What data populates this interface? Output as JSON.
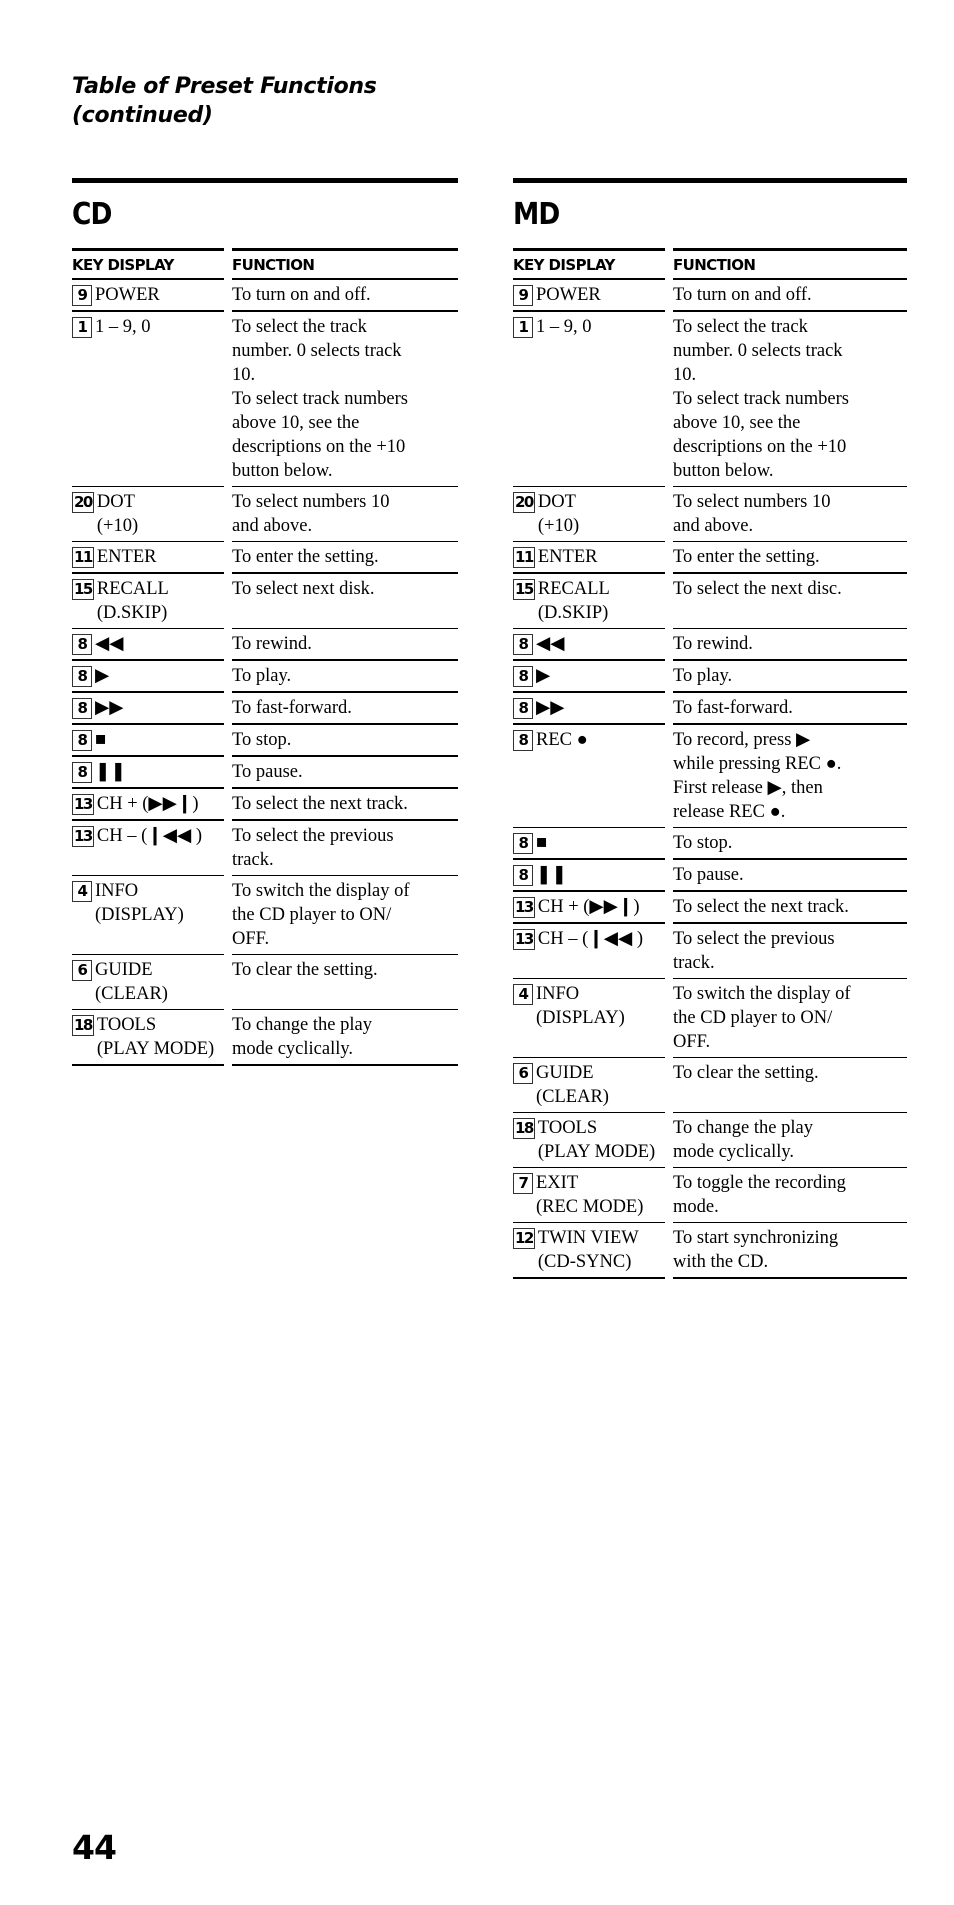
{
  "title": "Table of Preset Functions\n(continued)",
  "title_lines": [
    "Table of Preset Functions",
    "(continued)"
  ],
  "page_number": "44",
  "sections": [
    {
      "name": "CD",
      "headers": {
        "key": "KEY DISPLAY",
        "function": "FUNCTION"
      },
      "rows": [
        {
          "key_num": "9",
          "key_label": "POWER",
          "function": "To turn on and off."
        },
        {
          "key_num": "1",
          "key_label": "1 – 9, 0",
          "function": "To select the track\nnumber. 0 selects track\n10.\nTo select track numbers\nabove 10, see the\ndescriptions on the +10\nbutton below."
        },
        {
          "key_num": "20",
          "key_label": "DOT\n(+10)",
          "function": "To select numbers 10\nand above."
        },
        {
          "key_num": "11",
          "key_label": "ENTER",
          "function": "To enter the setting."
        },
        {
          "key_num": "15",
          "key_label": "RECALL\n(D.SKIP)",
          "function": "To select next disk."
        },
        {
          "key_num": "8",
          "key_label": "◀◀",
          "function": "To rewind."
        },
        {
          "key_num": "8",
          "key_label": "▶",
          "function": "To play."
        },
        {
          "key_num": "8",
          "key_label": "▶▶",
          "function": "To fast-forward."
        },
        {
          "key_num": "8",
          "key_label": "■",
          "function": "To stop."
        },
        {
          "key_num": "8",
          "key_label": "❚❚",
          "function": "To pause."
        },
        {
          "key_num": "13",
          "key_label": "CH + (▶▶❙)",
          "function": "To select the next track."
        },
        {
          "key_num": "13",
          "key_label": "CH – (❙◀◀ )",
          "function": "To select the previous\ntrack."
        },
        {
          "key_num": "4",
          "key_label": "INFO\n(DISPLAY)",
          "function": "To switch the display of\nthe CD player to ON/\nOFF."
        },
        {
          "key_num": "6",
          "key_label": "GUIDE\n(CLEAR)",
          "function": "To clear the setting."
        },
        {
          "key_num": "18",
          "key_label": "TOOLS\n(PLAY MODE)",
          "function": "To change the play\nmode cyclically."
        }
      ]
    },
    {
      "name": "MD",
      "headers": {
        "key": "KEY DISPLAY",
        "function": "FUNCTION"
      },
      "rows": [
        {
          "key_num": "9",
          "key_label": "POWER",
          "function": "To turn on and off."
        },
        {
          "key_num": "1",
          "key_label": "1 – 9, 0",
          "function": "To select the track\nnumber. 0 selects track\n10.\nTo select track numbers\nabove 10, see the\ndescriptions on the +10\nbutton below."
        },
        {
          "key_num": "20",
          "key_label": "DOT\n(+10)",
          "function": "To select numbers 10\nand above."
        },
        {
          "key_num": "11",
          "key_label": "ENTER",
          "function": "To enter the setting."
        },
        {
          "key_num": "15",
          "key_label": "RECALL\n(D.SKIP)",
          "function": "To select the next disc."
        },
        {
          "key_num": "8",
          "key_label": "◀◀",
          "function": "To rewind."
        },
        {
          "key_num": "8",
          "key_label": "▶",
          "function": "To play."
        },
        {
          "key_num": "8",
          "key_label": "▶▶",
          "function": "To fast-forward."
        },
        {
          "key_num": "8",
          "key_label": "REC ●",
          "function": "To record, press ▶\nwhile pressing REC ●.\nFirst release ▶, then\nrelease REC ●."
        },
        {
          "key_num": "8",
          "key_label": "■",
          "function": "To stop."
        },
        {
          "key_num": "8",
          "key_label": "❚❚",
          "function": "To pause."
        },
        {
          "key_num": "13",
          "key_label": "CH + (▶▶❙)",
          "function": "To select the next track."
        },
        {
          "key_num": "13",
          "key_label": "CH – (❙◀◀ )",
          "function": "To select the previous\ntrack."
        },
        {
          "key_num": "4",
          "key_label": "INFO\n(DISPLAY)",
          "function": "To switch the display of\nthe CD player to ON/\nOFF."
        },
        {
          "key_num": "6",
          "key_label": "GUIDE\n(CLEAR)",
          "function": "To clear the setting."
        },
        {
          "key_num": "18",
          "key_label": "TOOLS\n(PLAY MODE)",
          "function": "To change the play\nmode cyclically."
        },
        {
          "key_num": "7",
          "key_label": "EXIT\n(REC MODE)",
          "function": "To toggle the recording\nmode."
        },
        {
          "key_num": "12",
          "key_label": "TWIN VIEW\n(CD-SYNC)",
          "function": "To start synchronizing\nwith the CD."
        }
      ]
    }
  ]
}
